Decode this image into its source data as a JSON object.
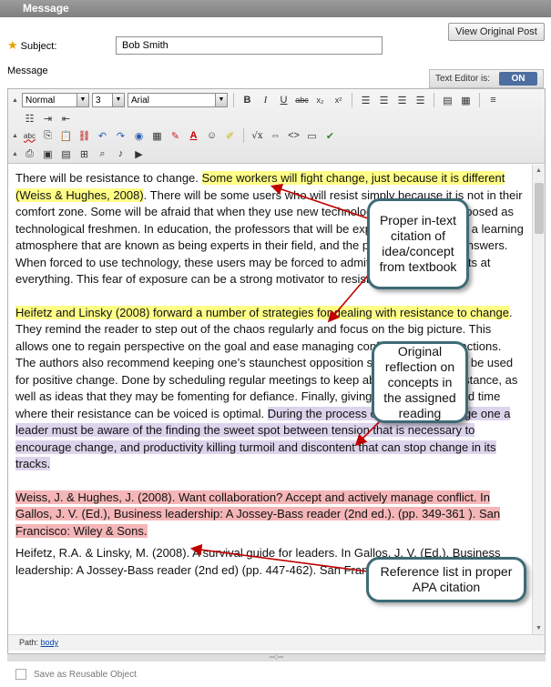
{
  "header": {
    "title": "Message"
  },
  "view_original_button": "View Original Post",
  "subject": {
    "label": "Subject:",
    "value": "Bob Smith"
  },
  "message_label": "Message",
  "text_editor": {
    "label": "Text Editor is:",
    "state": "ON"
  },
  "toolbar": {
    "format_select": "Normal",
    "size_select": "3",
    "font_select": "Arial",
    "icons": [
      "bold-icon",
      "italic-icon",
      "underline-icon",
      "strikethrough-icon",
      "subscript-icon",
      "superscript-icon",
      "align-left-icon",
      "align-center-icon",
      "align-right-icon",
      "justify-icon",
      "insert-file-icon",
      "paste-word-icon",
      "numbered-list-icon",
      "bullet-list-icon",
      "indent-icon",
      "outdent-icon",
      "spellcheck-icon",
      "copy-icon",
      "paste-icon",
      "link-icon",
      "undo-icon",
      "redo-icon",
      "table-icon",
      "text-color-icon",
      "highlight-color-icon",
      "math-icon",
      "html-icon",
      "source-icon",
      "preview-icon",
      "check-icon",
      "image-icon",
      "media-icon"
    ],
    "labels": {
      "bold": "B",
      "italic": "I",
      "underline": "U",
      "strike": "abc",
      "sub": "x₂",
      "sup": "x²",
      "spell": "abc",
      "math": "√x"
    }
  },
  "content": {
    "p1_before": "There will be resistance to change. ",
    "p1_highlight": "Some workers will fight change, just because it is different (Weiss   &   Hughes, 2008)",
    "p1_after": ". There will be some users who will resist simply because it is not in their comfort zone. Some will be afraid that when they use new technologies they will be exposed as technological freshmen. In education, the professors that will be expected to move into a learning atmosphere that are known as being experts in their field, and the people with all the answers. When forced to use technology, these users may be forced to admit they are not experts at everything. This fear of exposure can be a strong motivator to resist change.",
    "p2_highlight": "Heifetz and Linsky (2008) forward a number of strategies for dealing with resistance to change",
    "p2_middle": ". They remind the reader to step out of the chaos regularly and focus on the big picture. This allows one to regain perspective on the goal and ease managing conflict in daily interactions. The authors also recommend keeping one’s staunchest opposition so their energy can be used for positive change. Done by scheduling regular meetings to keep abreast of their resistance, as well as ideas that they may be fomenting for defiance. Finally, giving the work back, and time where their resistance can be voiced is optimal.  ",
    "p2_purple": "During the process of managing change one a leader must be aware of the finding the sweet spot between tension that is necessary to encourage change, and productivity killing turmoil and discontent that can stop change in its tracks.",
    "ref1": "Weiss, J. & Hughes, J. (2008). Want collaboration? Accept and actively manage conflict. In Gallos, J. V. (Ed.), Business leadership: A Jossey-Bass reader (2nd ed.). (pp. 349-361 ). San Francisco: Wiley & Sons.",
    "ref2": "Heifetz, R.A. & Linsky, M. (2008). A survival guide for leaders. In Gallos, J. V. (Ed.), Business leadership: A Jossey-Bass reader (2nd ed) (pp. 447-462). San Francisco: Wiley & Sons."
  },
  "pathbar": {
    "label": "Path:",
    "link": "body"
  },
  "reusable_label": "Save as Reusable Object",
  "callouts": {
    "intext": "Proper in-text citation of idea/concept from textbook",
    "reflection": "Original reflection on concepts in the assigned reading",
    "reference": "Reference list in proper APA citation"
  },
  "colors": {
    "header": "#8a8a8a",
    "callout_border": "#3e6b76",
    "arrow": "#c00000",
    "highlight_yellow": "#ffff88",
    "highlight_purple": "#dcd4ec",
    "highlight_pink": "#f5b6b8"
  }
}
